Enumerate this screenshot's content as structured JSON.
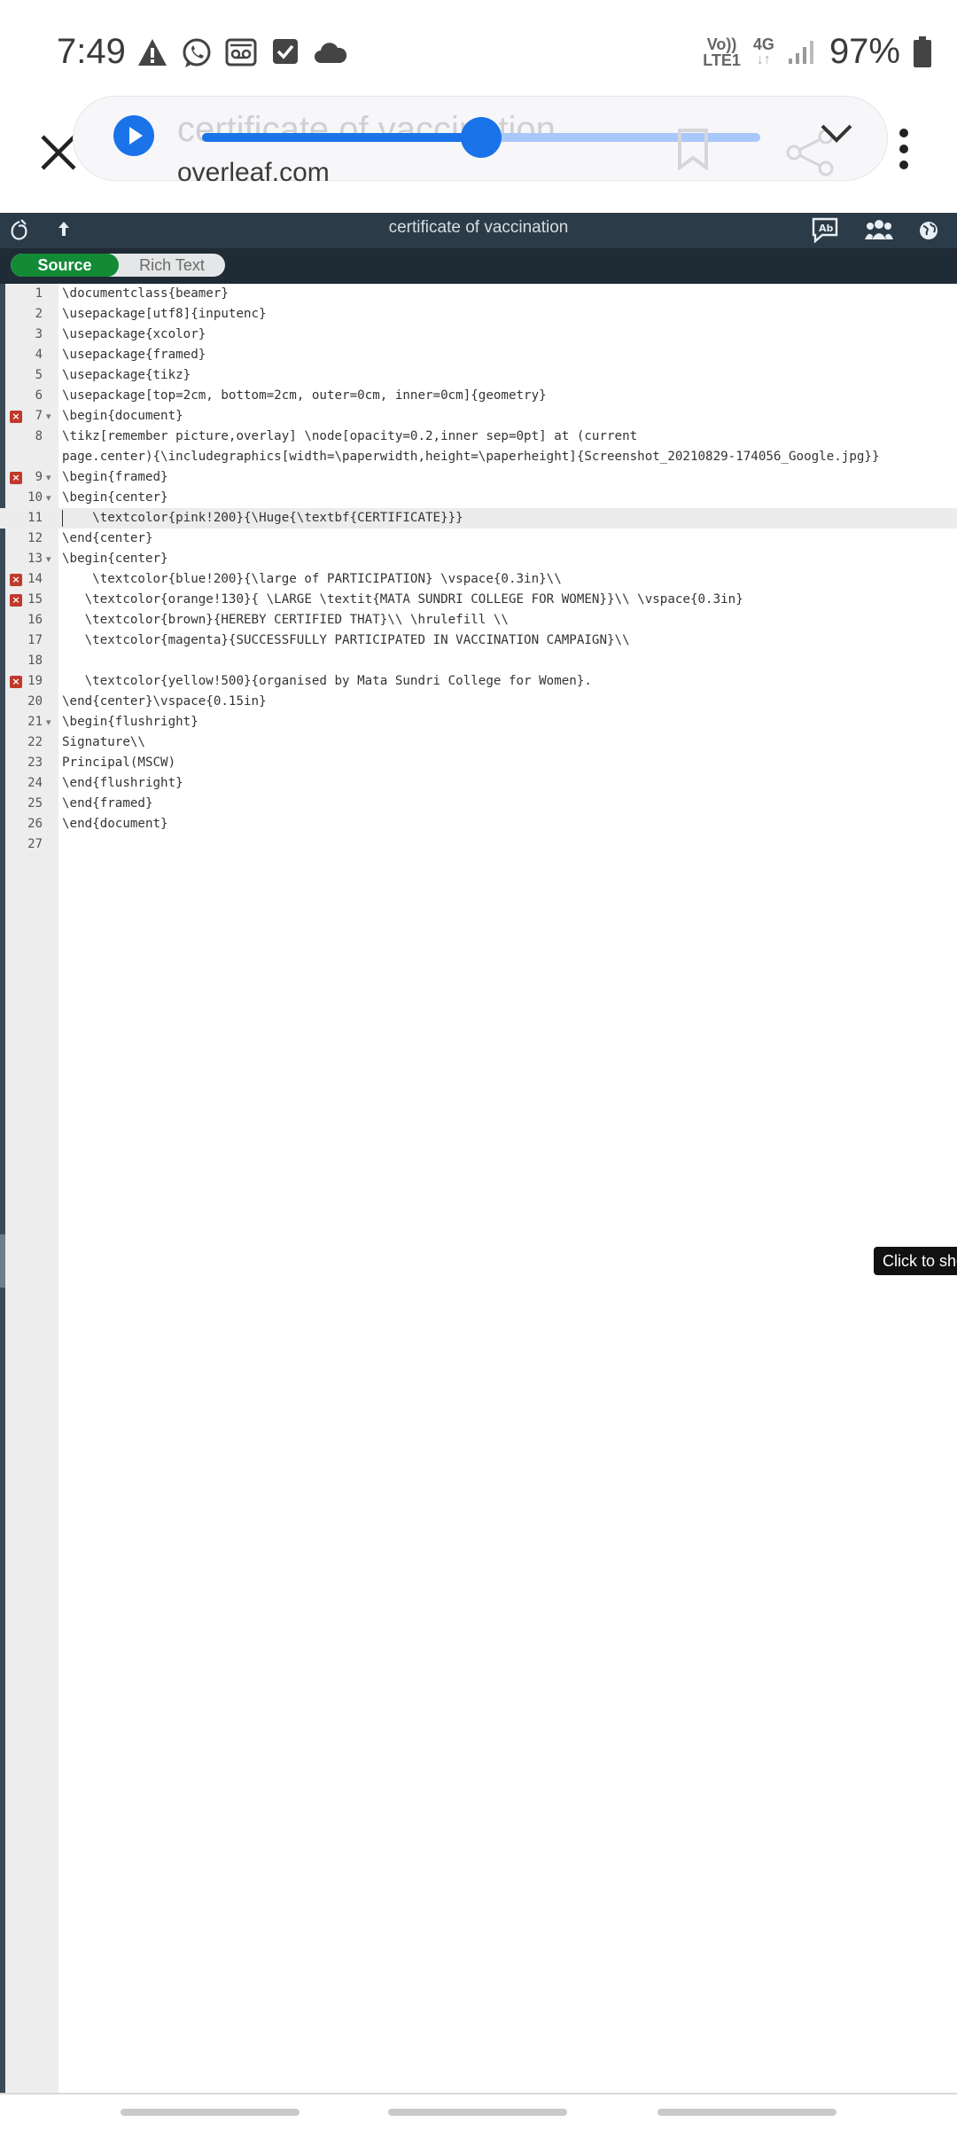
{
  "status_bar": {
    "time": "7:49",
    "left_icons": [
      "warning-icon",
      "whatsapp-icon",
      "voicemail-icon",
      "checkbox-icon",
      "cloud-icon"
    ],
    "network_top": "Vo))",
    "network_bottom": "LTE1",
    "network_type": "4G",
    "battery_percent": "97%"
  },
  "browser": {
    "page_title": "certificate of vaccination ...",
    "domain": "overleaf.com",
    "media_progress_percent": 50
  },
  "editor_toolbar": {
    "title": "certificate of vaccination"
  },
  "mode_toggle": {
    "source_label": "Source",
    "rich_text_label": "Rich Text",
    "selected": "Source"
  },
  "editor": {
    "current_line": 11,
    "lines": [
      {
        "num": "1",
        "text": "\\documentclass{beamer}",
        "fold": false,
        "error": false
      },
      {
        "num": "2",
        "text": "\\usepackage[utf8]{inputenc}",
        "fold": false,
        "error": false
      },
      {
        "num": "3",
        "text": "\\usepackage{xcolor}",
        "fold": false,
        "error": false
      },
      {
        "num": "4",
        "text": "\\usepackage{framed}",
        "fold": false,
        "error": false
      },
      {
        "num": "5",
        "text": "\\usepackage{tikz}",
        "fold": false,
        "error": false
      },
      {
        "num": "6",
        "text": "\\usepackage[top=2cm, bottom=2cm, outer=0cm, inner=0cm]{geometry}",
        "fold": false,
        "error": false
      },
      {
        "num": "7",
        "text": "\\begin{document}",
        "fold": true,
        "error": true
      },
      {
        "num": "8",
        "text": "\\tikz[remember picture,overlay] \\node[opacity=0.2,inner sep=0pt] at (current",
        "fold": false,
        "error": false
      },
      {
        "num": "",
        "text": "page.center){\\includegraphics[width=\\paperwidth,height=\\paperheight]{Screenshot_20210829-174056_Google.jpg}}",
        "fold": false,
        "error": false
      },
      {
        "num": "9",
        "text": "\\begin{framed}",
        "fold": true,
        "error": true
      },
      {
        "num": "10",
        "text": "\\begin{center}",
        "fold": true,
        "error": false
      },
      {
        "num": "11",
        "text": "    \\textcolor{pink!200}{\\Huge{\\textbf{CERTIFICATE}}}",
        "fold": false,
        "error": false
      },
      {
        "num": "12",
        "text": "\\end{center}",
        "fold": false,
        "error": false
      },
      {
        "num": "13",
        "text": "\\begin{center}",
        "fold": true,
        "error": false
      },
      {
        "num": "14",
        "text": "    \\textcolor{blue!200}{\\large of PARTICIPATION} \\vspace{0.3in}\\\\",
        "fold": false,
        "error": true
      },
      {
        "num": "15",
        "text": "   \\textcolor{orange!130}{ \\LARGE \\textit{MATA SUNDRI COLLEGE FOR WOMEN}}\\\\ \\vspace{0.3in}",
        "fold": false,
        "error": true
      },
      {
        "num": "16",
        "text": "   \\textcolor{brown}{HEREBY CERTIFIED THAT}\\\\ \\hrulefill \\\\",
        "fold": false,
        "error": false
      },
      {
        "num": "17",
        "text": "   \\textcolor{magenta}{SUCCESSFULLY PARTICIPATED IN VACCINATION CAMPAIGN}\\\\",
        "fold": false,
        "error": false
      },
      {
        "num": "18",
        "text": "",
        "fold": false,
        "error": false
      },
      {
        "num": "19",
        "text": "   \\textcolor{yellow!500}{organised by Mata Sundri College for Women}.",
        "fold": false,
        "error": true
      },
      {
        "num": "20",
        "text": "\\end{center}\\vspace{0.15in}",
        "fold": false,
        "error": false
      },
      {
        "num": "21",
        "text": "\\begin{flushright}",
        "fold": true,
        "error": false
      },
      {
        "num": "22",
        "text": "Signature\\\\",
        "fold": false,
        "error": false
      },
      {
        "num": "23",
        "text": "Principal(MSCW)",
        "fold": false,
        "error": false
      },
      {
        "num": "24",
        "text": "\\end{flushright}",
        "fold": false,
        "error": false
      },
      {
        "num": "25",
        "text": "\\end{framed}",
        "fold": false,
        "error": false
      },
      {
        "num": "26",
        "text": "\\end{document}",
        "fold": false,
        "error": false
      },
      {
        "num": "27",
        "text": "",
        "fold": false,
        "error": false
      }
    ]
  },
  "tooltip": {
    "text": "Click to sho"
  },
  "colors": {
    "accent_blue": "#1a73e8",
    "toolbar_bg": "#2c3b48",
    "source_green": "#138a36",
    "error_red": "#c0392b"
  }
}
